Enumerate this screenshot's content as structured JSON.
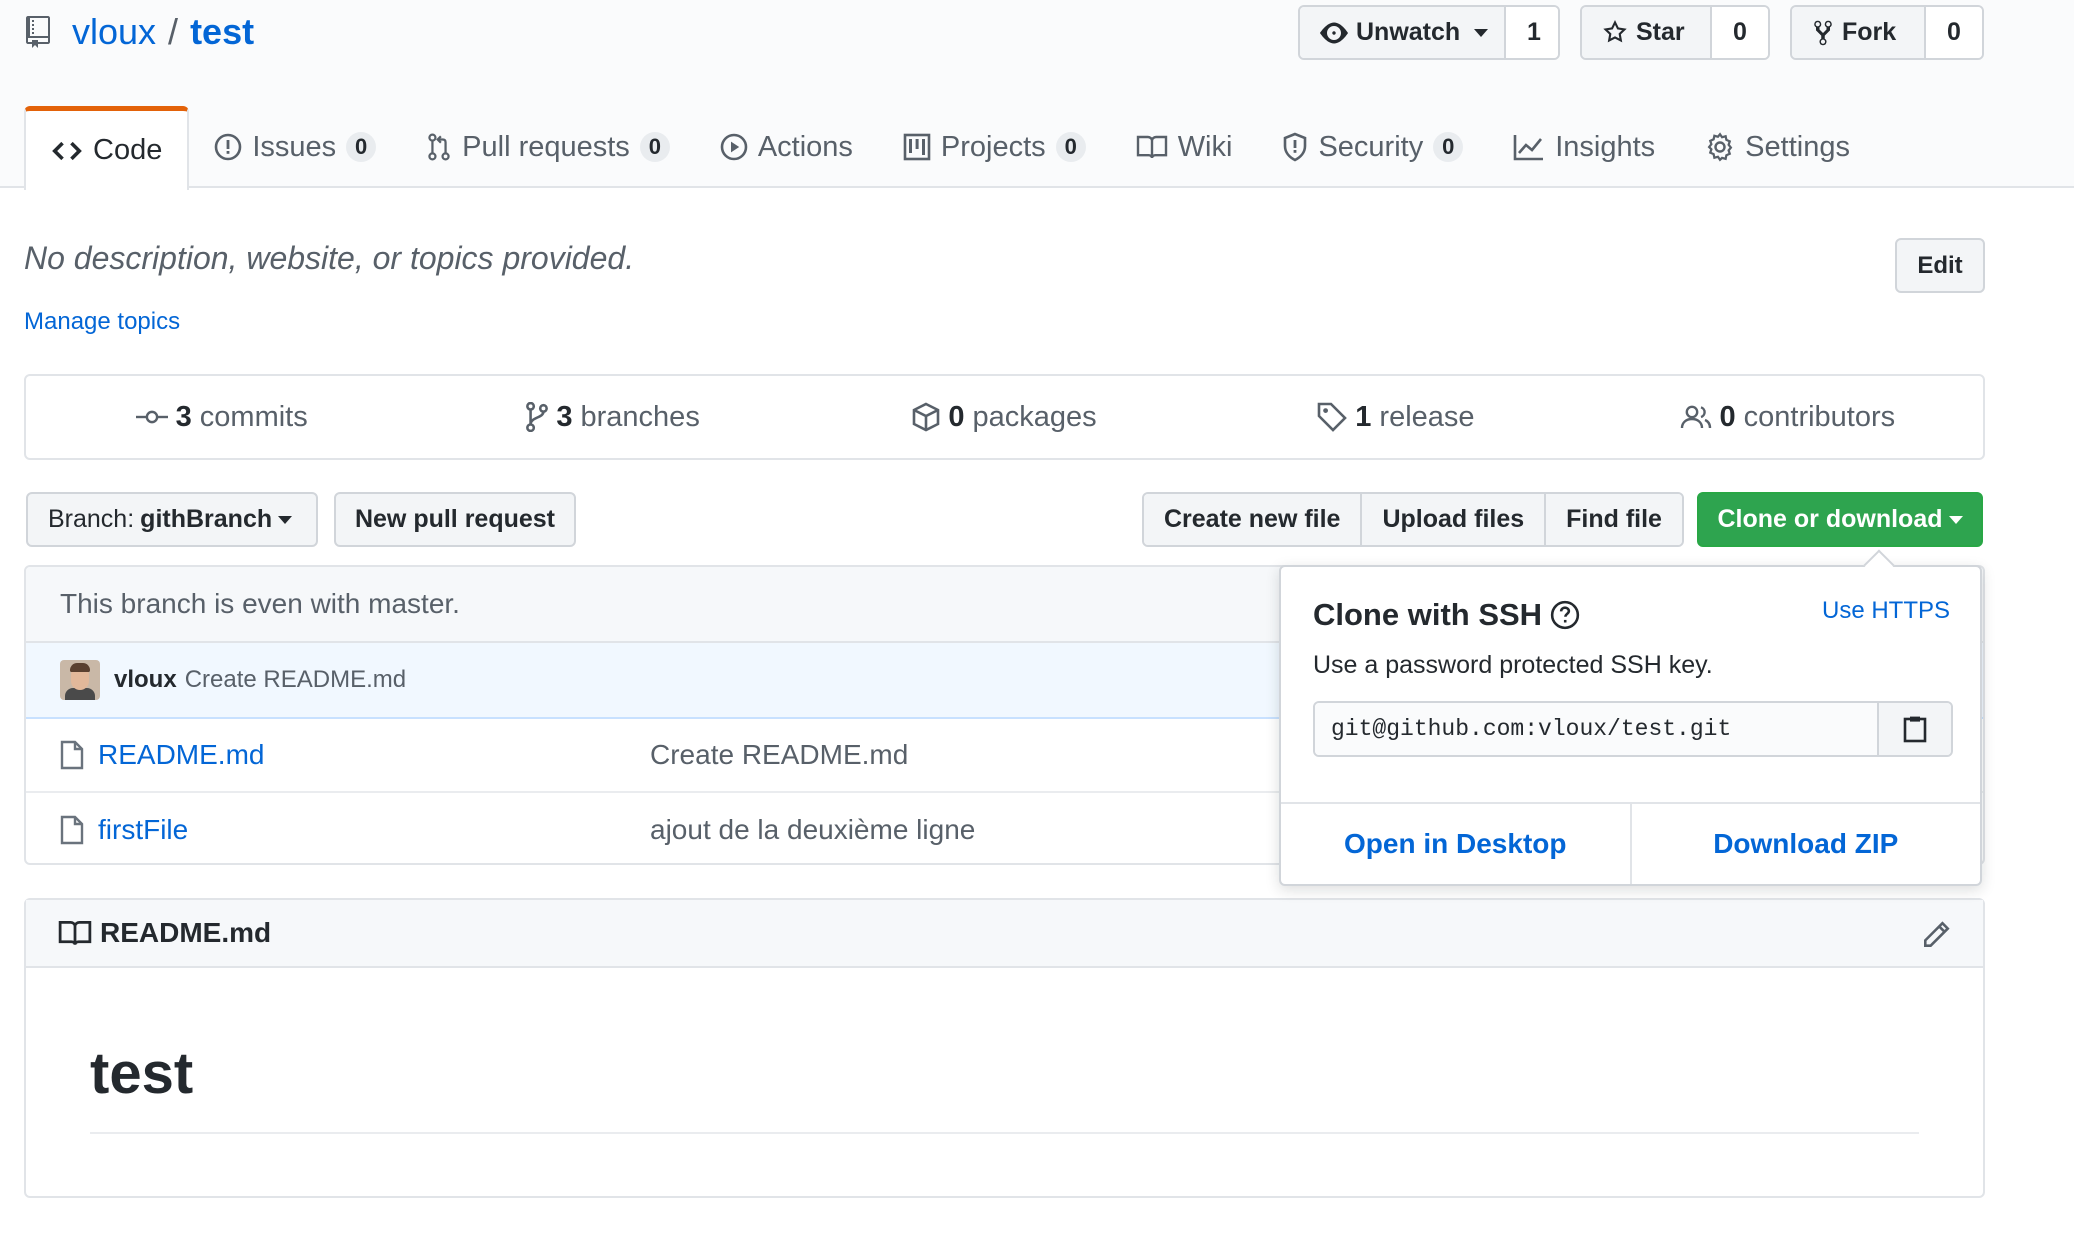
{
  "repo": {
    "owner": "vloux",
    "separator": "/",
    "name": "test"
  },
  "actions": {
    "watch": {
      "label": "Unwatch",
      "count": "1"
    },
    "star": {
      "label": "Star",
      "count": "0"
    },
    "fork": {
      "label": "Fork",
      "count": "0"
    }
  },
  "tabs": [
    {
      "label": "Code",
      "count": null,
      "active": true,
      "icon": "code-icon"
    },
    {
      "label": "Issues",
      "count": "0",
      "icon": "issue-icon"
    },
    {
      "label": "Pull requests",
      "count": "0",
      "icon": "pull-request-icon"
    },
    {
      "label": "Actions",
      "count": null,
      "icon": "play-icon"
    },
    {
      "label": "Projects",
      "count": "0",
      "icon": "project-icon"
    },
    {
      "label": "Wiki",
      "count": null,
      "icon": "book-icon"
    },
    {
      "label": "Security",
      "count": "0",
      "icon": "shield-icon"
    },
    {
      "label": "Insights",
      "count": null,
      "icon": "graph-icon"
    },
    {
      "label": "Settings",
      "count": null,
      "icon": "gear-icon"
    }
  ],
  "about": {
    "description": "No description, website, or topics provided.",
    "manage_topics": "Manage topics",
    "edit": "Edit"
  },
  "summary": {
    "commits": {
      "num": "3",
      "label": "commits"
    },
    "branches": {
      "num": "3",
      "label": "branches"
    },
    "packages": {
      "num": "0",
      "label": "packages"
    },
    "releases": {
      "num": "1",
      "label": "release"
    },
    "contributors": {
      "num": "0",
      "label": "contributors"
    }
  },
  "filenav": {
    "branch_prefix": "Branch:",
    "branch_name": "githBranch",
    "new_pr": "New pull request",
    "create_file": "Create new file",
    "upload_files": "Upload files",
    "find_file": "Find file",
    "clone": "Clone or download"
  },
  "branch_status": "This branch is even with master.",
  "latest_commit": {
    "author": "vloux",
    "message": "Create README.md"
  },
  "files": [
    {
      "name": "README.md",
      "message": "Create README.md"
    },
    {
      "name": "firstFile",
      "message": "ajout de la deuxième ligne"
    }
  ],
  "readme": {
    "filename": "README.md",
    "heading": "test"
  },
  "clone_popover": {
    "title": "Clone with SSH",
    "switch_link": "Use HTTPS",
    "subtitle": "Use a password protected SSH key.",
    "url": "git@github.com:vloux/test.git",
    "open_desktop": "Open in Desktop",
    "download_zip": "Download ZIP"
  },
  "colors": {
    "accent_link": "#0366d6",
    "primary_button": "#2ea44f",
    "active_tab_border": "#e36209"
  }
}
